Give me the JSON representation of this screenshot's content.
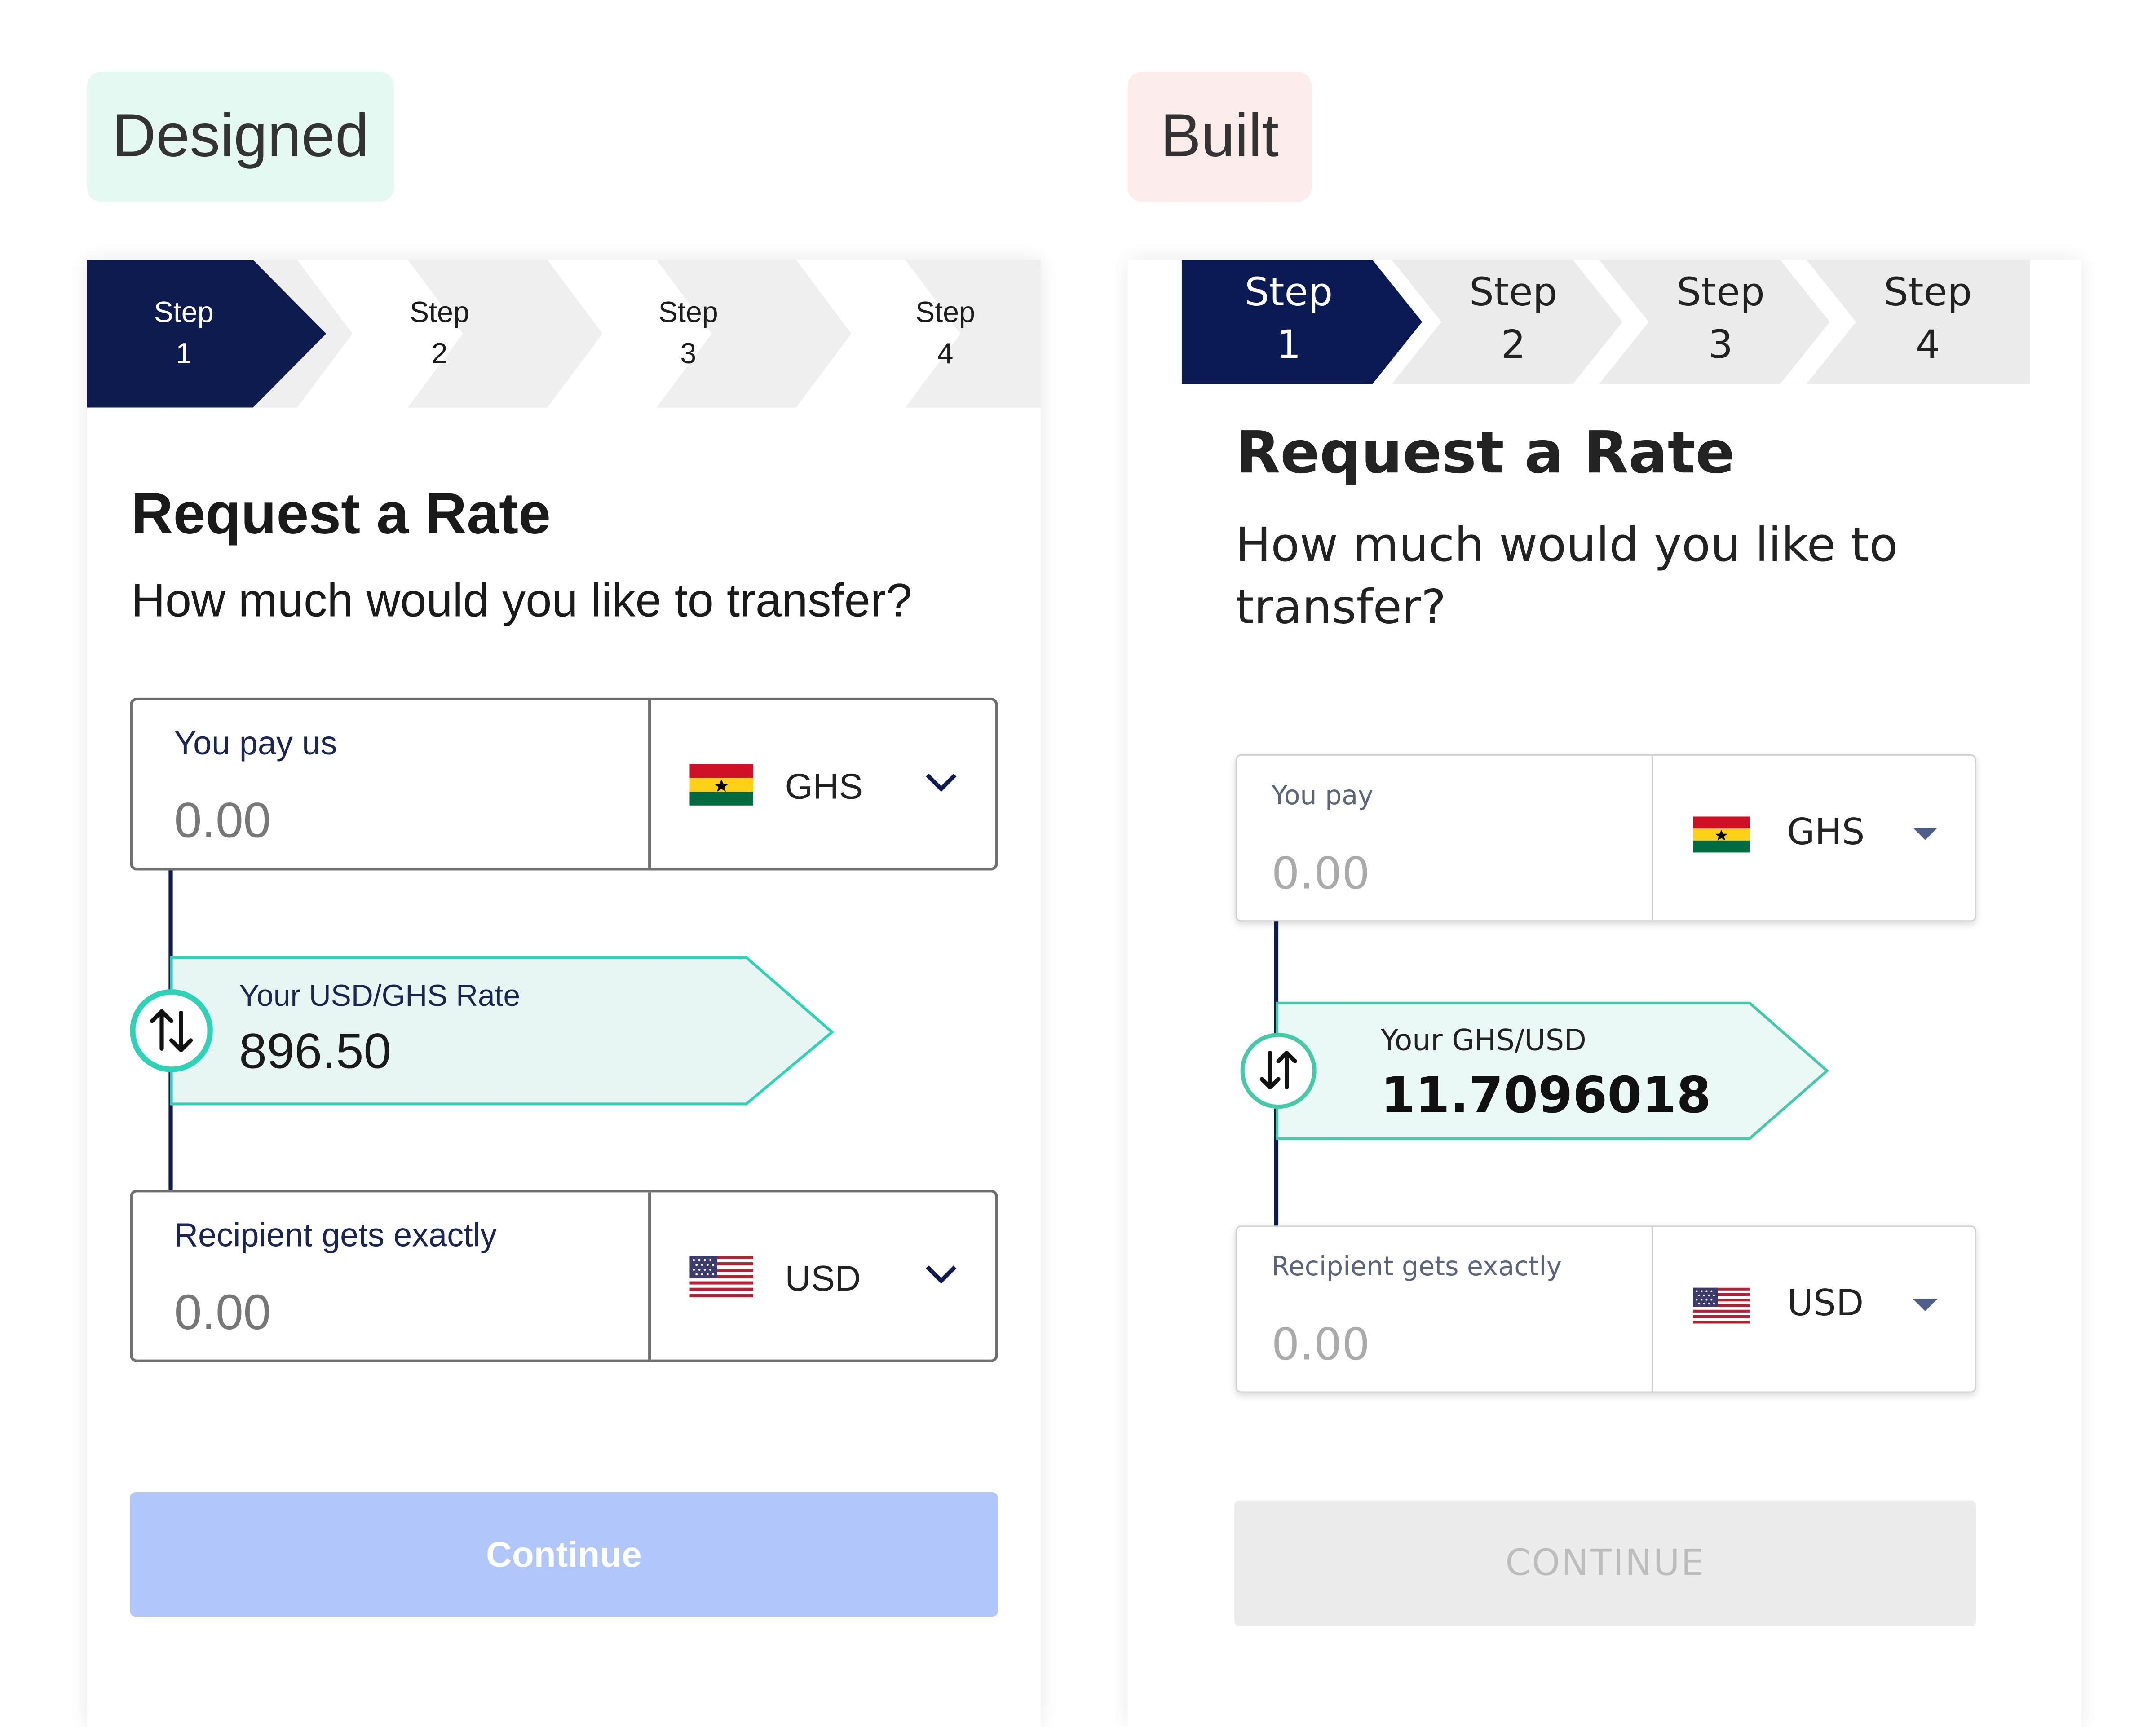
{
  "labels": {
    "designed": "Designed",
    "built": "Built"
  },
  "designed": {
    "steps": [
      {
        "word": "Step",
        "num": "1"
      },
      {
        "word": "Step",
        "num": "2"
      },
      {
        "word": "Step",
        "num": "3"
      },
      {
        "word": "Step",
        "num": "4"
      }
    ],
    "active_step": 1,
    "title": "Request a Rate",
    "subtitle": "How much would you like to transfer?",
    "pay": {
      "label": "You pay us",
      "amount": "0.00",
      "currency": "GHS"
    },
    "rate": {
      "label": "Your USD/GHS Rate",
      "value": "896.50"
    },
    "receive": {
      "label": "Recipient gets exactly",
      "amount": "0.00",
      "currency": "USD"
    },
    "continue_label": "Continue",
    "colors": {
      "navy": "#0d1b4e",
      "teal": "#2ed3b7",
      "continue_bg": "#b1c6fb"
    }
  },
  "built": {
    "steps": [
      {
        "word": "Step",
        "num": "1"
      },
      {
        "word": "Step",
        "num": "2"
      },
      {
        "word": "Step",
        "num": "3"
      },
      {
        "word": "Step",
        "num": "4"
      }
    ],
    "active_step": 1,
    "title": "Request a Rate",
    "subtitle": "How much would you like to transfer?",
    "pay": {
      "label": "You pay",
      "amount": "0.00",
      "currency": "GHS"
    },
    "rate": {
      "label": "Your GHS/USD",
      "value": "11.7096018"
    },
    "receive": {
      "label": "Recipient gets exactly",
      "amount": "0.00",
      "currency": "USD"
    },
    "continue_label": "CONTINUE",
    "colors": {
      "navy": "#0d1b4e",
      "teal": "#46c9a9",
      "continue_bg": "#ececec"
    }
  },
  "icons": {
    "swap": "swap-arrows-icon",
    "dropdown_designed": "chevron-down-icon",
    "dropdown_built": "caret-down-icon",
    "flag_ghs": "ghana-flag-icon",
    "flag_usd": "us-flag-icon"
  }
}
